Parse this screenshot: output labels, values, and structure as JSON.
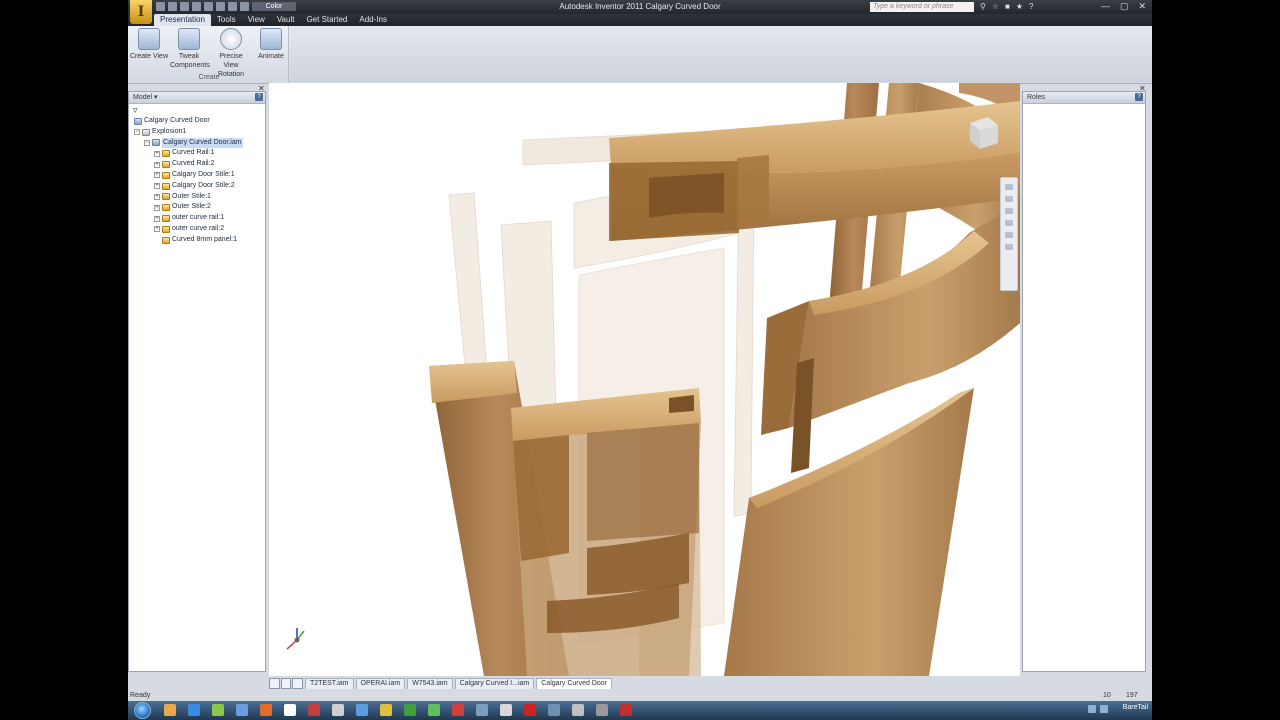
{
  "window": {
    "app_letter": "I",
    "title": "Autodesk Inventor 2011   Calgary Curved Door",
    "search_placeholder": "Type a keyword or phrase",
    "qat_dropdown": "Color"
  },
  "ribbon_tabs": [
    {
      "label": "Presentation",
      "active": true
    },
    {
      "label": "Tools",
      "active": false
    },
    {
      "label": "View",
      "active": false
    },
    {
      "label": "Vault",
      "active": false
    },
    {
      "label": "Get Started",
      "active": false
    },
    {
      "label": "Add-Ins",
      "active": false
    }
  ],
  "ribbon": {
    "buttons": [
      {
        "line1": "Create View",
        "line2": ""
      },
      {
        "line1": "Tweak",
        "line2": "Components"
      },
      {
        "line1": "Precise View",
        "line2": "Rotation"
      },
      {
        "line1": "Animate",
        "line2": ""
      }
    ],
    "panel_title": "Create"
  },
  "browser": {
    "title": "Model ▾",
    "root": "Calgary Curved Door",
    "explosion": "Explosion1",
    "assembly": "Calgary Curved Door.iam",
    "parts": [
      "Curved Rail:1",
      "Curved Rail:2",
      "Calgary Door Stile:1",
      "Calgary Door Stile:2",
      "Outer Stile:1",
      "Outer Stile:2",
      "outer curve rail:1",
      "outer curve rail:2",
      "Curved 8mm panel:1"
    ]
  },
  "roles_panel": {
    "title": "Roles"
  },
  "document_tabs": [
    {
      "label": "T2TEST.iam",
      "active": false
    },
    {
      "label": "OPERAI.iam",
      "active": false
    },
    {
      "label": "W7543.iam",
      "active": false
    },
    {
      "label": "Calgary Curved I...iam",
      "active": false
    },
    {
      "label": "Calgary Curved Door",
      "active": true
    }
  ],
  "status": {
    "text": "Ready",
    "value1": "10",
    "value2": "197"
  },
  "taskbar": {
    "clock": "BareTail",
    "apps": [
      "#e8a94a",
      "#3b8be0",
      "#8cc84b",
      "#6a9ee0",
      "#e36c2c",
      "#ffffff",
      "#c04040",
      "#d0d0d0",
      "#5aa0e0",
      "#e0c040",
      "#40a040",
      "#60c060",
      "#d04040",
      "#7aa0c0",
      "#d9d9d9",
      "#cc2222",
      "#7090b0",
      "#c0c0c0",
      "#9a9a9a",
      "#c03030"
    ]
  },
  "colors": {
    "wood_light": "#d7b17a",
    "wood_mid": "#b88a57",
    "wood_dark": "#8a5f2e",
    "ghost": "#efe7dc"
  }
}
